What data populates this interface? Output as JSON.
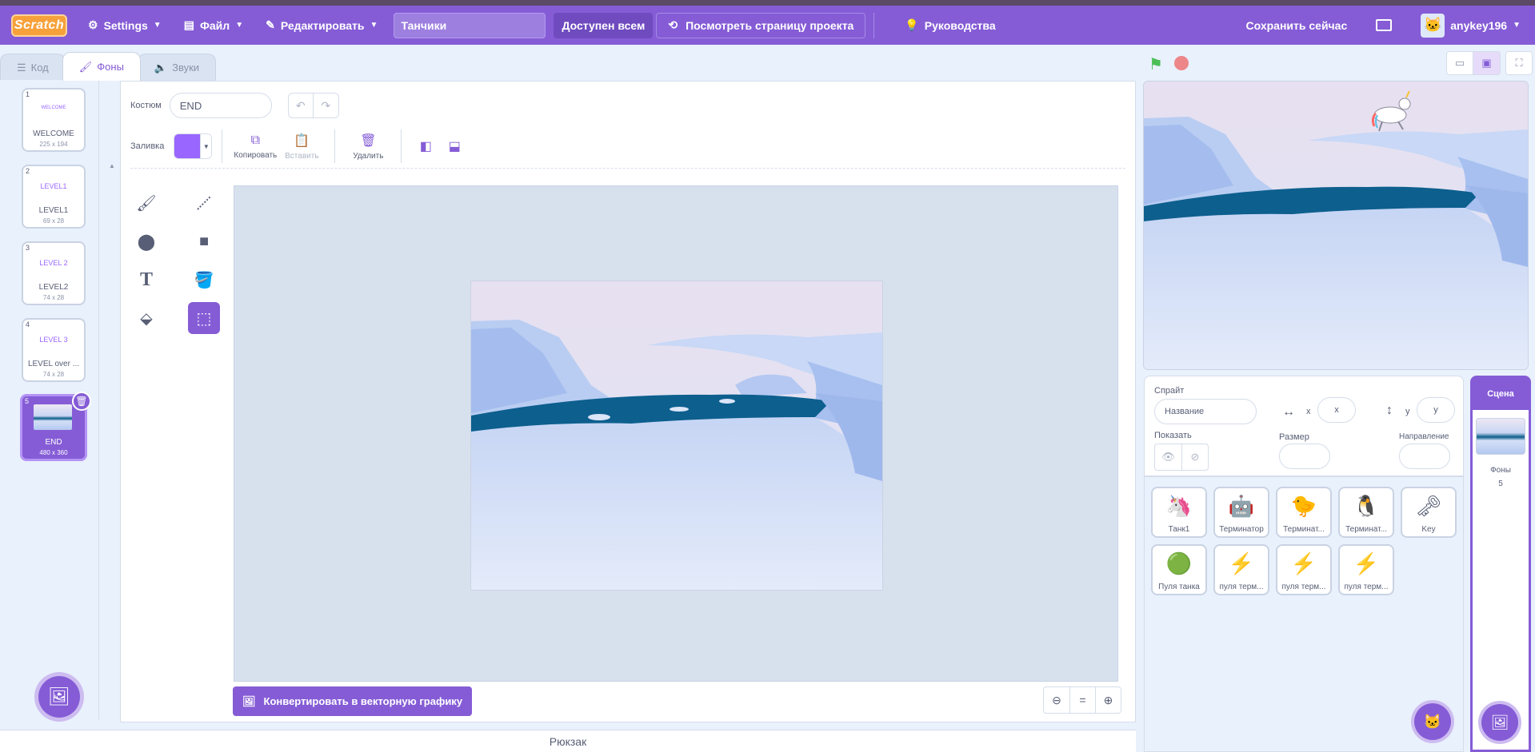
{
  "menubar": {
    "logo_text": "Scratch",
    "settings_label": "Settings",
    "file_label": "Файл",
    "edit_label": "Редактировать",
    "project_title": "Танчики",
    "share_label": "Доступен всем",
    "see_project_label": "Посмотреть страницу проекта",
    "tutorials_label": "Руководства",
    "save_label": "Сохранить сейчас",
    "username": "anykey196"
  },
  "tabs": [
    {
      "label": "Код",
      "active": false
    },
    {
      "label": "Фоны",
      "active": true
    },
    {
      "label": "Звуки",
      "active": false
    }
  ],
  "costumes": [
    {
      "num": "1",
      "name": "WELCOME",
      "size": "225 x 194",
      "thumb": "WELCOME"
    },
    {
      "num": "2",
      "name": "LEVEL1",
      "size": "69 x 28",
      "thumb": "LEVEL1"
    },
    {
      "num": "3",
      "name": "LEVEL2",
      "size": "74 x 28",
      "thumb": "LEVEL 2"
    },
    {
      "num": "4",
      "name": "LEVEL over ...",
      "size": "74 x 28",
      "thumb": "LEVEL 3"
    },
    {
      "num": "5",
      "name": "END",
      "size": "480 x 360",
      "selected": true
    }
  ],
  "editor": {
    "costume_label": "Костюм",
    "costume_name": "END",
    "fill_label": "Заливка",
    "fill_color": "#9966ff",
    "copy_label": "Копировать",
    "paste_label": "Вставить",
    "delete_label": "Удалить",
    "convert_label": "Конвертировать в векторную графику",
    "zoom_reset": "="
  },
  "backpack_label": "Рюкзак",
  "sprite_info": {
    "sprite_label": "Спрайт",
    "name_placeholder": "Название",
    "x_label": "x",
    "x_placeholder": "x",
    "y_label": "y",
    "y_placeholder": "y",
    "show_label": "Показать",
    "size_label": "Размер",
    "direction_label": "Направление"
  },
  "sprites": [
    {
      "name": "Танк1",
      "icon": "unicorn"
    },
    {
      "name": "Терминатор",
      "icon": "robot"
    },
    {
      "name": "Терминат...",
      "icon": "chick"
    },
    {
      "name": "Терминат...",
      "icon": "penguin"
    },
    {
      "name": "Key",
      "icon": "key"
    },
    {
      "name": "Пуля танка",
      "icon": "green-ball"
    },
    {
      "name": "пуля терм...",
      "icon": "lightning"
    },
    {
      "name": "пуля терм...",
      "icon": "lightning"
    },
    {
      "name": "пуля терм...",
      "icon": "lightning"
    }
  ],
  "scene": {
    "title": "Сцена",
    "backdrops_label": "Фоны",
    "backdrops_count": "5"
  },
  "colors": {
    "accent": "#855cd6",
    "background": "#e9f1fc",
    "go_flag": "#4cbf56",
    "stop": "#ec5959"
  }
}
